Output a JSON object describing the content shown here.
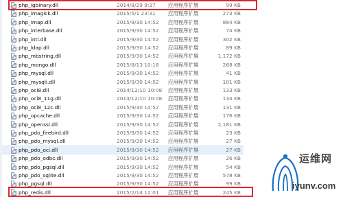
{
  "files": [
    {
      "name": "php_igbinary.dll",
      "date": "2014/8/29 9:37",
      "type": "应用程序扩展",
      "size": "99 KB"
    },
    {
      "name": "php_imagick.dll",
      "date": "2015/5/1 23:31",
      "type": "应用程序扩展",
      "size": "273 KB"
    },
    {
      "name": "php_imap.dll",
      "date": "2015/9/30 14:52",
      "type": "应用程序扩展",
      "size": "884 KB"
    },
    {
      "name": "php_interbase.dll",
      "date": "2015/9/30 14:52",
      "type": "应用程序扩展",
      "size": "74 KB"
    },
    {
      "name": "php_intl.dll",
      "date": "2015/9/30 14:52",
      "type": "应用程序扩展",
      "size": "302 KB"
    },
    {
      "name": "php_ldap.dll",
      "date": "2015/9/30 14:52",
      "type": "应用程序扩展",
      "size": "89 KB"
    },
    {
      "name": "php_mbstring.dll",
      "date": "2015/9/30 14:52",
      "type": "应用程序扩展",
      "size": "1,172 KB"
    },
    {
      "name": "php_mongo.dll",
      "date": "2015/8/13 10:18",
      "type": "应用程序扩展",
      "size": "268 KB"
    },
    {
      "name": "php_mysql.dll",
      "date": "2015/9/30 14:52",
      "type": "应用程序扩展",
      "size": "41 KB"
    },
    {
      "name": "php_mysqli.dll",
      "date": "2015/9/30 14:52",
      "type": "应用程序扩展",
      "size": "101 KB"
    },
    {
      "name": "php_oci8.dll",
      "date": "2014/12/10 10:08",
      "type": "应用程序扩展",
      "size": "133 KB"
    },
    {
      "name": "php_oci8_11g.dll",
      "date": "2014/12/10 10:08",
      "type": "应用程序扩展",
      "size": "134 KB"
    },
    {
      "name": "php_oci8_12c.dll",
      "date": "2015/9/30 14:52",
      "type": "应用程序扩展",
      "size": "131 KB"
    },
    {
      "name": "php_opcache.dll",
      "date": "2015/9/30 14:52",
      "type": "应用程序扩展",
      "size": "176 KB"
    },
    {
      "name": "php_openssl.dll",
      "date": "2015/9/30 14:52",
      "type": "应用程序扩展",
      "size": "2,181 KB"
    },
    {
      "name": "php_pdo_firebird.dll",
      "date": "2015/9/30 14:52",
      "type": "应用程序扩展",
      "size": "23 KB"
    },
    {
      "name": "php_pdo_mysql.dll",
      "date": "2015/9/30 14:52",
      "type": "应用程序扩展",
      "size": "27 KB"
    },
    {
      "name": "php_pdo_oci.dll",
      "date": "2015/9/30 14:52",
      "type": "应用程序扩展",
      "size": "27 KB"
    },
    {
      "name": "php_pdo_odbc.dll",
      "date": "2015/9/30 14:52",
      "type": "应用程序扩展",
      "size": "26 KB"
    },
    {
      "name": "php_pdo_pgsql.dll",
      "date": "2015/9/30 14:52",
      "type": "应用程序扩展",
      "size": "54 KB"
    },
    {
      "name": "php_pdo_sqlite.dll",
      "date": "2015/9/30 14:52",
      "type": "应用程序扩展",
      "size": "578 KB"
    },
    {
      "name": "php_pgsql.dll",
      "date": "2015/9/30 14:52",
      "type": "应用程序扩展",
      "size": "99 KB"
    },
    {
      "name": "php_redis.dll",
      "date": "2015/2/14 12:01",
      "type": "应用程序扩展",
      "size": "245 KB"
    }
  ],
  "watermark": {
    "brand_cn": "运维网",
    "brand_en": "iyunv.com",
    "accent_color": "#1a6fc9"
  }
}
